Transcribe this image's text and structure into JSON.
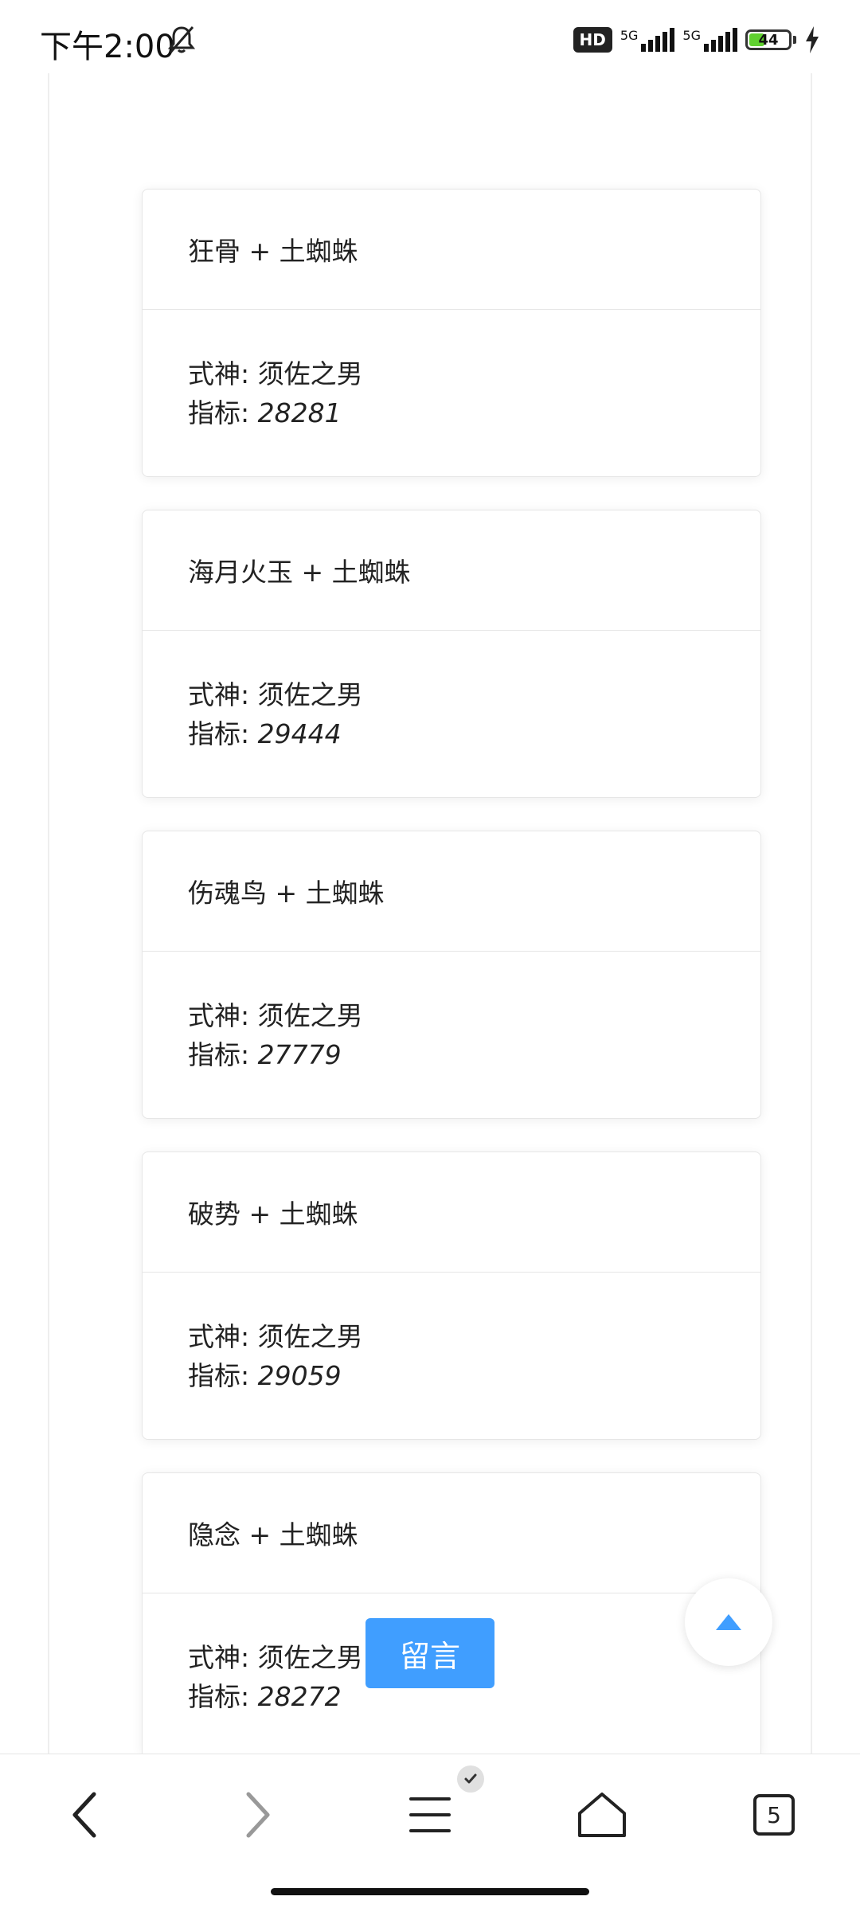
{
  "status_bar": {
    "time": "下午2:00",
    "hd_label": "HD",
    "network_1": "5G",
    "network_2": "5G",
    "battery_level": "44",
    "battery_fill_percent": 44,
    "battery_color": "#5fd02f"
  },
  "cards": [
    {
      "title": "狂骨 + 土蜘蛛",
      "shikigami_label": "式神: ",
      "shikigami": "须佐之男",
      "metric_label": "指标: ",
      "metric": "28281"
    },
    {
      "title": "海月火玉 + 土蜘蛛",
      "shikigami_label": "式神: ",
      "shikigami": "须佐之男",
      "metric_label": "指标: ",
      "metric": "29444"
    },
    {
      "title": "伤魂鸟 + 土蜘蛛",
      "shikigami_label": "式神: ",
      "shikigami": "须佐之男",
      "metric_label": "指标: ",
      "metric": "27779"
    },
    {
      "title": "破势 + 土蜘蛛",
      "shikigami_label": "式神: ",
      "shikigami": "须佐之男",
      "metric_label": "指标: ",
      "metric": "29059"
    },
    {
      "title": "隐念 + 土蜘蛛",
      "shikigami_label": "式神: ",
      "shikigami": "须佐之男",
      "metric_label": "指标: ",
      "metric": "28272"
    }
  ],
  "comment_button": {
    "label": "留言",
    "color": "#409eff"
  },
  "back_to_top": {
    "icon": "triangle-up-icon",
    "color": "#409eff"
  },
  "bottom_nav": {
    "back": "chevron-left-icon",
    "forward": "chevron-right-icon",
    "menu": "menu-icon",
    "home": "home-icon",
    "tab_count": "5"
  }
}
